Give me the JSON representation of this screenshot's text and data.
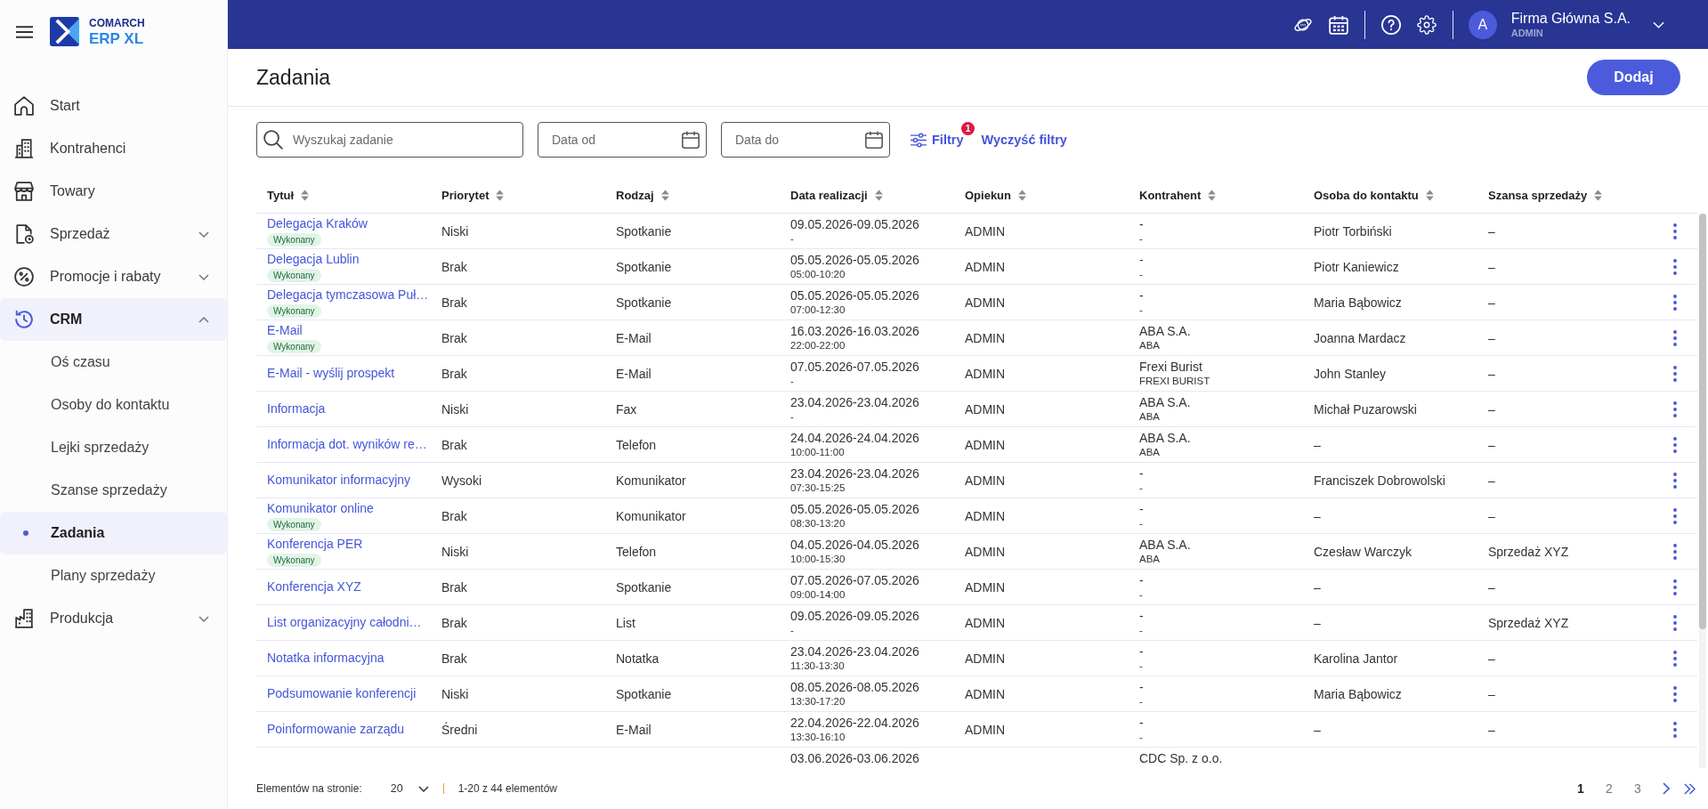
{
  "sidebar": {
    "logo": {
      "line1": "COMARCH",
      "line2": "ERP XL"
    },
    "items": [
      {
        "kind": "link",
        "label": "Start"
      },
      {
        "kind": "link",
        "label": "Kontrahenci"
      },
      {
        "kind": "link",
        "label": "Towary"
      },
      {
        "kind": "group",
        "label": "Sprzedaż",
        "expanded": false
      },
      {
        "kind": "group",
        "label": "Promocje i rabaty",
        "expanded": false
      },
      {
        "kind": "group",
        "label": "CRM",
        "expanded": true,
        "children": [
          {
            "label": "Oś czasu",
            "selected": false
          },
          {
            "label": "Osoby do kontaktu",
            "selected": false
          },
          {
            "label": "Lejki sprzedaży",
            "selected": false
          },
          {
            "label": "Szanse sprzedaży",
            "selected": false
          },
          {
            "label": "Zadania",
            "selected": true
          },
          {
            "label": "Plany sprzedaży",
            "selected": false
          }
        ]
      },
      {
        "kind": "group",
        "label": "Produkcja",
        "expanded": false
      }
    ]
  },
  "top_bar": {
    "avatar": "A",
    "company": "Firma Główna S.A.",
    "user": "ADMIN"
  },
  "page": {
    "title": "Zadania",
    "add_button": "Dodaj"
  },
  "filters": {
    "search": {
      "placeholder": "Wyszukaj zadanie"
    },
    "date_from": {
      "placeholder": "Data od"
    },
    "date_to": {
      "placeholder": "Data do"
    },
    "filters_button": {
      "label": "Filtry",
      "badge": "1"
    },
    "clear_button": "Wyczyść filtry"
  },
  "table": {
    "columns": [
      {
        "label": "Tytuł"
      },
      {
        "label": "Priorytet"
      },
      {
        "label": "Rodzaj"
      },
      {
        "label": "Data realizacji"
      },
      {
        "label": "Opiekun"
      },
      {
        "label": "Kontrahent"
      },
      {
        "label": "Osoba do kontaktu"
      },
      {
        "label": "Szansa sprzedaży"
      }
    ],
    "rows": [
      {
        "title": "Delegacja Kraków",
        "status": "Wykonany",
        "priority": "Niski",
        "type": "Spotkanie",
        "date": "09.05.2026-09.05.2026",
        "time": "-",
        "owner": "ADMIN",
        "company": "-",
        "company_code": "-",
        "contact": "Piotr Torbiński",
        "opportunity": "–"
      },
      {
        "title": "Delegacja Lublin",
        "status": "Wykonany",
        "priority": "Brak",
        "type": "Spotkanie",
        "date": "05.05.2026-05.05.2026",
        "time": "05:00-10:20",
        "owner": "ADMIN",
        "company": "-",
        "company_code": "-",
        "contact": "Piotr Kaniewicz",
        "opportunity": "–"
      },
      {
        "title": "Delegacja tymczasowa Puł…",
        "status": "Wykonany",
        "priority": "Brak",
        "type": "Spotkanie",
        "date": "05.05.2026-05.05.2026",
        "time": "07:00-12:30",
        "owner": "ADMIN",
        "company": "-",
        "company_code": "-",
        "contact": "Maria Bąbowicz",
        "opportunity": "–"
      },
      {
        "title": "E-Mail",
        "status": "Wykonany",
        "priority": "Brak",
        "type": "E-Mail",
        "date": "16.03.2026-16.03.2026",
        "time": "22:00-22:00",
        "owner": "ADMIN",
        "company": "ABA S.A.",
        "company_code": "ABA",
        "contact": "Joanna Mardacz",
        "opportunity": "–"
      },
      {
        "title": "E-Mail - wyślij prospekt",
        "priority": "Brak",
        "type": "E-Mail",
        "date": "07.05.2026-07.05.2026",
        "time": "-",
        "owner": "ADMIN",
        "company": "Frexi Burist",
        "company_code": "FREXI BURIST",
        "contact": "John Stanley",
        "opportunity": "–"
      },
      {
        "title": "Informacja",
        "priority": "Niski",
        "type": "Fax",
        "date": "23.04.2026-23.04.2026",
        "time": "-",
        "owner": "ADMIN",
        "company": "ABA S.A.",
        "company_code": "ABA",
        "contact": "Michał Puzarowski",
        "opportunity": "–"
      },
      {
        "title": "Informacja dot. wyników re…",
        "priority": "Brak",
        "type": "Telefon",
        "date": "24.04.2026-24.04.2026",
        "time": "10:00-11:00",
        "owner": "ADMIN",
        "company": "ABA S.A.",
        "company_code": "ABA",
        "contact": "–",
        "opportunity": "–"
      },
      {
        "title": "Komunikator informacyjny",
        "priority": "Wysoki",
        "type": "Komunikator",
        "date": "23.04.2026-23.04.2026",
        "time": "07:30-15:25",
        "owner": "ADMIN",
        "company": "-",
        "company_code": "-",
        "contact": "Franciszek Dobrowolski",
        "opportunity": "–"
      },
      {
        "title": "Komunikator online",
        "status": "Wykonany",
        "priority": "Brak",
        "type": "Komunikator",
        "date": "05.05.2026-05.05.2026",
        "time": "08:30-13:20",
        "owner": "ADMIN",
        "company": "-",
        "company_code": "-",
        "contact": "–",
        "opportunity": "–"
      },
      {
        "title": "Konferencja PER",
        "status": "Wykonany",
        "priority": "Niski",
        "type": "Telefon",
        "date": "04.05.2026-04.05.2026",
        "time": "10:00-15:30",
        "owner": "ADMIN",
        "company": "ABA S.A.",
        "company_code": "ABA",
        "contact": "Czesław Warczyk",
        "opportunity": "Sprzedaż XYZ"
      },
      {
        "title": "Konferencja XYZ",
        "priority": "Brak",
        "type": "Spotkanie",
        "date": "07.05.2026-07.05.2026",
        "time": "09:00-14:00",
        "owner": "ADMIN",
        "company": "-",
        "company_code": "-",
        "contact": "–",
        "opportunity": "–"
      },
      {
        "title": "List organizacyjny całodni…",
        "priority": "Brak",
        "type": "List",
        "date": "09.05.2026-09.05.2026",
        "time": "-",
        "owner": "ADMIN",
        "company": "-",
        "company_code": "-",
        "contact": "–",
        "opportunity": "Sprzedaż XYZ"
      },
      {
        "title": "Notatka informacyjna",
        "priority": "Brak",
        "type": "Notatka",
        "date": "23.04.2026-23.04.2026",
        "time": "11:30-13:30",
        "owner": "ADMIN",
        "company": "-",
        "company_code": "-",
        "contact": "Karolina Jantor",
        "opportunity": "–"
      },
      {
        "title": "Podsumowanie konferencji",
        "priority": "Niski",
        "type": "Spotkanie",
        "date": "08.05.2026-08.05.2026",
        "time": "13:30-17:20",
        "owner": "ADMIN",
        "company": "-",
        "company_code": "-",
        "contact": "Maria Bąbowicz",
        "opportunity": "–"
      },
      {
        "title": "Poinformowanie zarządu",
        "priority": "Średni",
        "type": "E-Mail",
        "date": "22.04.2026-22.04.2026",
        "time": "13:30-16:10",
        "owner": "ADMIN",
        "company": "-",
        "company_code": "-",
        "contact": "–",
        "opportunity": "–"
      },
      {
        "date": "03.06.2026-03.06.2026",
        "company": "CDC Sp. z o.o."
      }
    ]
  },
  "footer": {
    "page_size_label": "Elementów na stronie:",
    "page_size": "20",
    "range": "1-20 z 44 elementów",
    "pages": [
      {
        "label": "1",
        "selected": true
      },
      {
        "label": "2",
        "selected": false
      },
      {
        "label": "3",
        "selected": false
      }
    ]
  }
}
